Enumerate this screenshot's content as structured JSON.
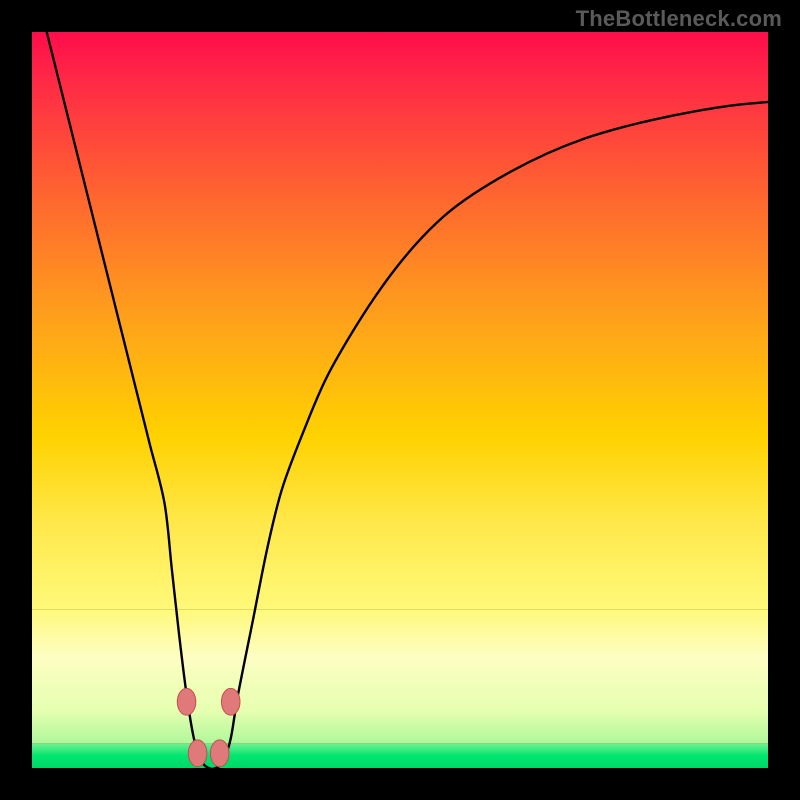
{
  "watermark": "TheBottleneck.com",
  "colors": {
    "top_gradient": "#ff0d4b",
    "mid_gradient": "#ffd500",
    "pale_band": "#fdfec2",
    "bottom_band": "#00e670",
    "curve": "#000000",
    "marker_fill": "#e07a7a",
    "marker_stroke": "#c24f4f"
  },
  "chart_data": {
    "type": "line",
    "title": "",
    "xlabel": "",
    "ylabel": "",
    "xlim": [
      0,
      100
    ],
    "ylim": [
      0,
      100
    ],
    "x": [
      2,
      4,
      6,
      8,
      10,
      12,
      14,
      16,
      18,
      19,
      20,
      21,
      22,
      23,
      24,
      25,
      26,
      27,
      28,
      30,
      32,
      34,
      37,
      40,
      44,
      48,
      52,
      56,
      60,
      65,
      70,
      75,
      80,
      85,
      90,
      95,
      100
    ],
    "y": [
      100,
      92,
      84,
      76,
      68,
      60,
      52,
      44,
      36,
      27,
      18,
      10,
      4,
      1,
      0,
      0,
      1,
      4,
      10,
      20,
      30,
      38,
      46,
      53,
      60,
      66,
      71,
      75,
      78,
      81,
      83.5,
      85.5,
      87,
      88.2,
      89.2,
      90,
      90.5
    ],
    "markers": [
      {
        "x": 21.0,
        "y": 9
      },
      {
        "x": 22.5,
        "y": 2
      },
      {
        "x": 25.5,
        "y": 2
      },
      {
        "x": 27.0,
        "y": 9
      }
    ],
    "marker_radius": 1.4,
    "green_band_top_y": 3.3,
    "green_band_bottom_y": 0,
    "pale_band_top_y": 21.5,
    "pale_band_bottom_y": 3.3
  }
}
